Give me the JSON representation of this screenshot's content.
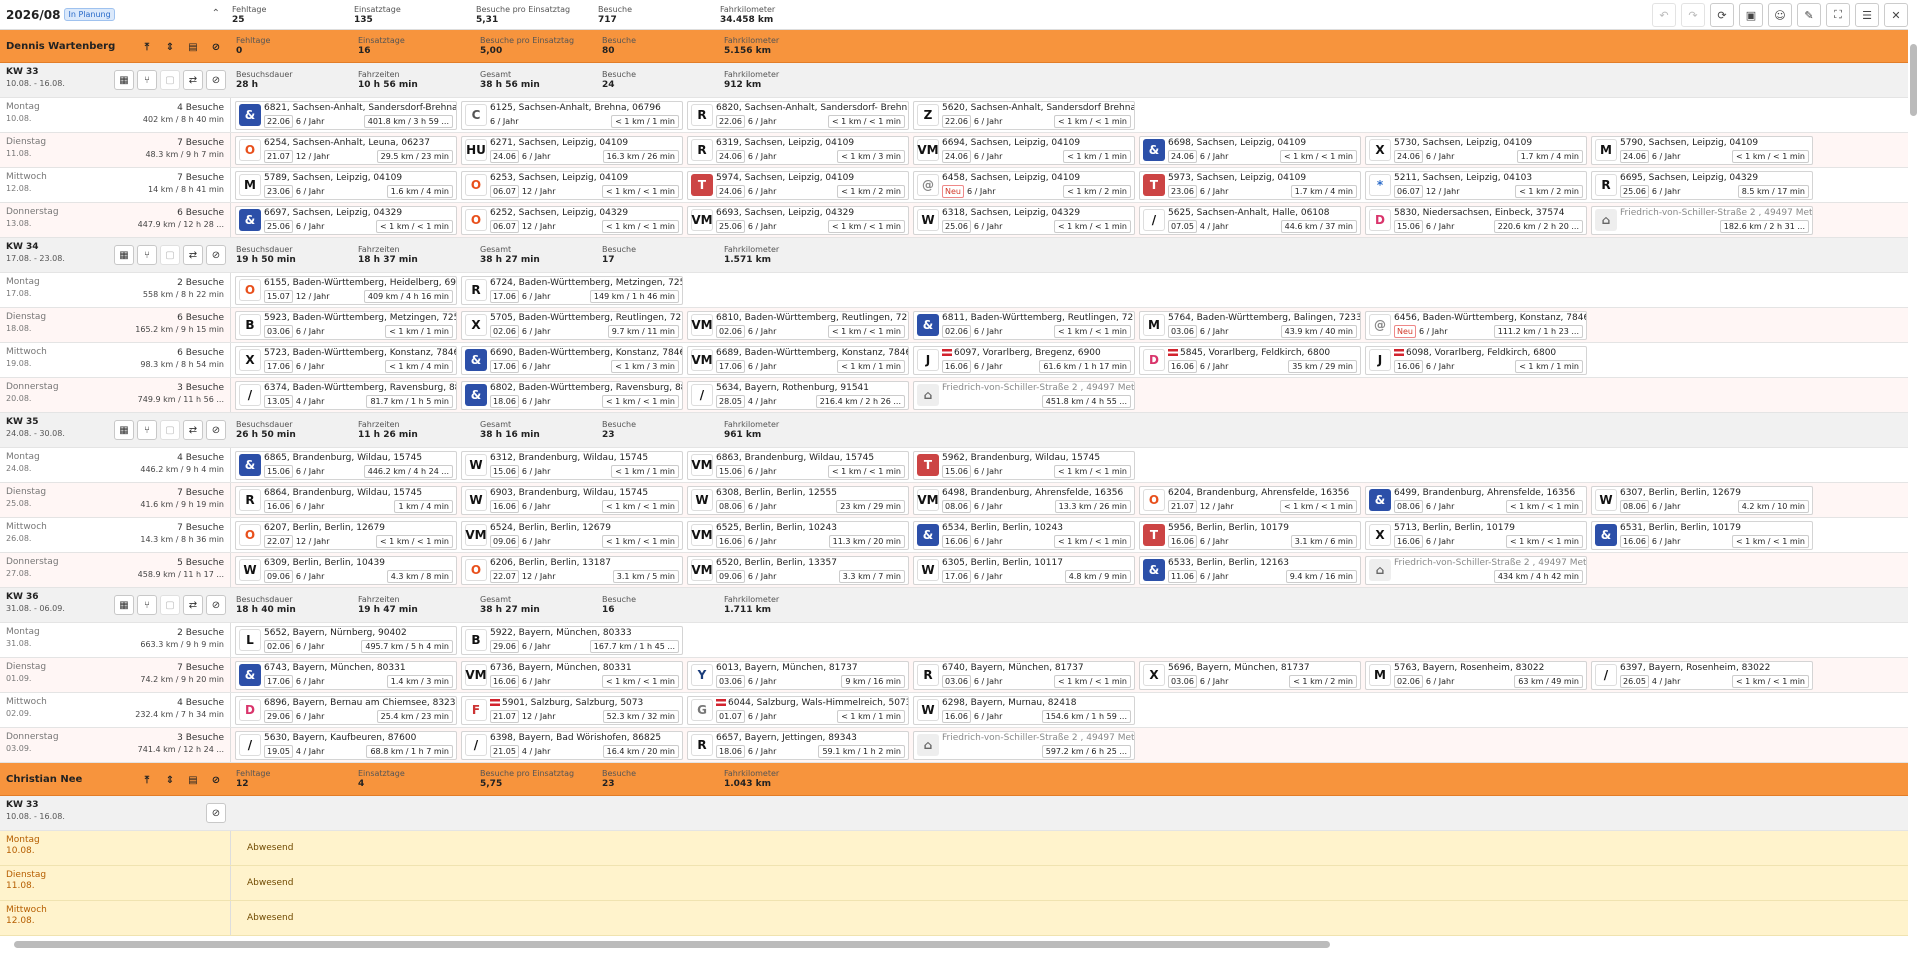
{
  "header": {
    "period": "2026/08",
    "status_badge": "In Planung",
    "stats": [
      [
        "Fehltage",
        "25"
      ],
      [
        "Einsatztage",
        "135"
      ],
      [
        "Besuche pro Einsatztag",
        "5,31"
      ],
      [
        "Besuche",
        "717"
      ],
      [
        "Fahrkilometer",
        "34.458 km"
      ]
    ]
  },
  "rows": [
    {
      "type": "emp",
      "name": "Dennis Wartenberg",
      "stats": [
        [
          "Fehltage",
          "0"
        ],
        [
          "Einsatztage",
          "16"
        ],
        [
          "Besuche pro Einsatztag",
          "5,00"
        ],
        [
          "Besuche",
          "80"
        ],
        [
          "Fahrkilometer",
          "5.156 km"
        ]
      ]
    },
    {
      "type": "wk",
      "week": "KW 33",
      "range": "10.08. - 16.08.",
      "stats": [
        [
          "Besuchsdauer",
          "28 h"
        ],
        [
          "Fahrzeiten",
          "10 h 56 min"
        ],
        [
          "Gesamt",
          "38 h 56 min"
        ],
        [
          "Besuche",
          "24"
        ],
        [
          "Fahrkilometer",
          "912 km"
        ]
      ]
    },
    {
      "type": "dy",
      "day": "Montag",
      "date": "10.08.",
      "visits": "4 Besuche",
      "sum": "402 km / 8 h 40 min",
      "cards": [
        [
          "&",
          "6821, Sachsen-Anhalt, Sandersdorf-Brehna...",
          "22.06",
          "6 / Jahr",
          "401.8 km / 3 h 59 ..."
        ],
        [
          "C",
          "6125, Sachsen-Anhalt, Brehna, 06796",
          "",
          "6 / Jahr",
          "< 1 km / 1 min"
        ],
        [
          "R",
          "6820, Sachsen-Anhalt, Sandersdorf- Brehn...",
          "22.06",
          "6 / Jahr",
          "< 1 km / < 1 min"
        ],
        [
          "Z",
          "5620, Sachsen-Anhalt, Sandersdorf Brehna...",
          "22.06",
          "6 / Jahr",
          "< 1 km / < 1 min"
        ]
      ]
    },
    {
      "type": "dy",
      "alt": true,
      "day": "Dienstag",
      "date": "11.08.",
      "visits": "7 Besuche",
      "sum": "48.3 km / 9 h 7 min",
      "cards": [
        [
          "O",
          "6254, Sachsen-Anhalt, Leuna, 06237",
          "21.07",
          "12 / Jahr",
          "29.5 km / 23 min"
        ],
        [
          "HU",
          "6271, Sachsen, Leipzig, 04109",
          "24.06",
          "6 / Jahr",
          "16.3 km / 26 min"
        ],
        [
          "R",
          "6319, Sachsen, Leipzig, 04109",
          "24.06",
          "6 / Jahr",
          "< 1 km / 3 min"
        ],
        [
          "VM",
          "6694, Sachsen, Leipzig, 04109",
          "24.06",
          "6 / Jahr",
          "< 1 km / 1 min"
        ],
        [
          "&",
          "6698, Sachsen, Leipzig, 04109",
          "24.06",
          "6 / Jahr",
          "< 1 km / < 1 min"
        ],
        [
          "X",
          "5730, Sachsen, Leipzig, 04109",
          "24.06",
          "6 / Jahr",
          "1.7 km / 4 min"
        ],
        [
          "M",
          "5790, Sachsen, Leipzig, 04109",
          "24.06",
          "6 / Jahr",
          "< 1 km / < 1 min"
        ]
      ]
    },
    {
      "type": "dy",
      "day": "Mittwoch",
      "date": "12.08.",
      "visits": "7 Besuche",
      "sum": "14 km / 8 h 41 min",
      "cards": [
        [
          "M",
          "5789, Sachsen, Leipzig, 04109",
          "23.06",
          "6 / Jahr",
          "1.6 km / 4 min"
        ],
        [
          "O",
          "6253, Sachsen, Leipzig, 04109",
          "06.07",
          "12 / Jahr",
          "< 1 km / < 1 min"
        ],
        [
          "T",
          "5974, Sachsen, Leipzig, 04109",
          "24.06",
          "6 / Jahr",
          "< 1 km / 2 min"
        ],
        [
          "@",
          "6458, Sachsen, Leipzig, 04109",
          "Neu",
          "6 / Jahr",
          "< 1 km / 2 min"
        ],
        [
          "T",
          "5973, Sachsen, Leipzig, 04109",
          "23.06",
          "6 / Jahr",
          "1.7 km / 4 min"
        ],
        [
          "*",
          "5211, Sachsen, Leipzig, 04103",
          "06.07",
          "12 / Jahr",
          "< 1 km / 2 min"
        ],
        [
          "R",
          "6695, Sachsen, Leipzig, 04329",
          "25.06",
          "6 / Jahr",
          "8.5 km / 17 min"
        ]
      ]
    },
    {
      "type": "dy",
      "alt": true,
      "day": "Donnerstag",
      "date": "13.08.",
      "visits": "6 Besuche",
      "sum": "447.9 km / 12 h 28 ...",
      "cards": [
        [
          "&",
          "6697, Sachsen, Leipzig, 04329",
          "25.06",
          "6 / Jahr",
          "< 1 km / < 1 min"
        ],
        [
          "O",
          "6252, Sachsen, Leipzig, 04329",
          "06.07",
          "12 / Jahr",
          "< 1 km / < 1 min"
        ],
        [
          "VM",
          "6693, Sachsen, Leipzig, 04329",
          "25.06",
          "6 / Jahr",
          "< 1 km / < 1 min"
        ],
        [
          "W",
          "6318, Sachsen, Leipzig, 04329",
          "25.06",
          "6 / Jahr",
          "< 1 km / < 1 min"
        ],
        [
          "/",
          "5625, Sachsen-Anhalt, Halle, 06108",
          "07.05",
          "4 / Jahr",
          "44.6 km / 37 min"
        ],
        [
          "D",
          "5830, Niedersachsen, Einbeck, 37574",
          "15.06",
          "6 / Jahr",
          "220.6 km / 2 h 20 ..."
        ],
        [
          "H",
          "Friedrich-von-Schiller-Straße 2 , 49497 Met...",
          "",
          "",
          "182.6 km / 2 h 31 ..."
        ]
      ]
    },
    {
      "type": "wk",
      "week": "KW 34",
      "range": "17.08. - 23.08.",
      "stats": [
        [
          "Besuchsdauer",
          "19 h 50 min"
        ],
        [
          "Fahrzeiten",
          "18 h 37 min"
        ],
        [
          "Gesamt",
          "38 h 27 min"
        ],
        [
          "Besuche",
          "17"
        ],
        [
          "Fahrkilometer",
          "1.571 km"
        ]
      ]
    },
    {
      "type": "dy",
      "day": "Montag",
      "date": "17.08.",
      "visits": "2 Besuche",
      "sum": "558 km / 8 h 22 min",
      "cards": [
        [
          "O",
          "6155, Baden-Württemberg, Heidelberg, 69...",
          "15.07",
          "12 / Jahr",
          "409 km / 4 h 16 min"
        ],
        [
          "R",
          "6724, Baden-Württemberg, Metzingen, 725...",
          "17.06",
          "6 / Jahr",
          "149 km / 1 h 46 min"
        ]
      ]
    },
    {
      "type": "dy",
      "alt": true,
      "day": "Dienstag",
      "date": "18.08.",
      "visits": "6 Besuche",
      "sum": "165.2 km / 9 h 15 min",
      "cards": [
        [
          "B",
          "5923, Baden-Württemberg, Metzingen, 725...",
          "03.06",
          "6 / Jahr",
          "< 1 km / 1 min"
        ],
        [
          "X",
          "5705, Baden-Württemberg, Reutlingen, 72...",
          "02.06",
          "6 / Jahr",
          "9.7 km / 11 min"
        ],
        [
          "VM",
          "6810, Baden-Württemberg, Reutlingen, 72...",
          "02.06",
          "6 / Jahr",
          "< 1 km / < 1 min"
        ],
        [
          "&",
          "6811, Baden-Württemberg, Reutlingen, 72...",
          "02.06",
          "6 / Jahr",
          "< 1 km / < 1 min"
        ],
        [
          "M",
          "5764, Baden-Württemberg, Balingen, 72336",
          "03.06",
          "6 / Jahr",
          "43.9 km / 40 min"
        ],
        [
          "@",
          "6456, Baden-Württemberg, Konstanz, 78462",
          "Neu",
          "6 / Jahr",
          "111.2 km / 1 h 23 ..."
        ]
      ]
    },
    {
      "type": "dy",
      "day": "Mittwoch",
      "date": "19.08.",
      "visits": "6 Besuche",
      "sum": "98.3 km / 8 h 54 min",
      "cards": [
        [
          "X",
          "5723, Baden-Württemberg, Konstanz, 78462",
          "17.06",
          "6 / Jahr",
          "< 1 km / 4 min"
        ],
        [
          "&",
          "6690, Baden-Württemberg, Konstanz, 78462",
          "17.06",
          "6 / Jahr",
          "< 1 km / 3 min"
        ],
        [
          "VM",
          "6689, Baden-Württemberg, Konstanz, 78462",
          "17.06",
          "6 / Jahr",
          "< 1 km / 1 min"
        ],
        [
          "J",
          "6097, Vorarlberg, Bregenz, 6900",
          "16.06",
          "6 / Jahr",
          "61.6 km / 1 h 17 min"
        ],
        [
          "D",
          "5845, Vorarlberg, Feldkirch, 6800",
          "16.06",
          "6 / Jahr",
          "35 km / 29 min"
        ],
        [
          "J",
          "6098, Vorarlberg, Feldkirch, 6800",
          "16.06",
          "6 / Jahr",
          "< 1 km / 1 min"
        ]
      ]
    },
    {
      "type": "dy",
      "alt": true,
      "day": "Donnerstag",
      "date": "20.08.",
      "visits": "3 Besuche",
      "sum": "749.9 km / 11 h 56 ...",
      "cards": [
        [
          "/",
          "6374, Baden-Württemberg, Ravensburg, 88...",
          "13.05",
          "4 / Jahr",
          "81.7 km / 1 h 5 min"
        ],
        [
          "&",
          "6802, Baden-Württemberg, Ravensburg, 88...",
          "18.06",
          "6 / Jahr",
          "< 1 km / < 1 min"
        ],
        [
          "/",
          "5634, Bayern, Rothenburg, 91541",
          "28.05",
          "4 / Jahr",
          "216.4 km / 2 h 26 ..."
        ],
        [
          "H",
          "Friedrich-von-Schiller-Straße 2 , 49497 Met...",
          "",
          "",
          "451.8 km / 4 h 55 ..."
        ]
      ]
    },
    {
      "type": "wk",
      "week": "KW 35",
      "range": "24.08. - 30.08.",
      "stats": [
        [
          "Besuchsdauer",
          "26 h 50 min"
        ],
        [
          "Fahrzeiten",
          "11 h 26 min"
        ],
        [
          "Gesamt",
          "38 h 16 min"
        ],
        [
          "Besuche",
          "23"
        ],
        [
          "Fahrkilometer",
          "961 km"
        ]
      ]
    },
    {
      "type": "dy",
      "day": "Montag",
      "date": "24.08.",
      "visits": "4 Besuche",
      "sum": "446.2 km / 9 h 4 min",
      "cards": [
        [
          "&",
          "6865, Brandenburg, Wildau, 15745",
          "15.06",
          "6 / Jahr",
          "446.2 km / 4 h 24 ..."
        ],
        [
          "W",
          "6312, Brandenburg, Wildau, 15745",
          "15.06",
          "6 / Jahr",
          "< 1 km / 1 min"
        ],
        [
          "VM",
          "6863, Brandenburg, Wildau, 15745",
          "15.06",
          "6 / Jahr",
          "< 1 km / < 1 min"
        ],
        [
          "T",
          "5962, Brandenburg, Wildau, 15745",
          "15.06",
          "6 / Jahr",
          "< 1 km / < 1 min"
        ]
      ]
    },
    {
      "type": "dy",
      "alt": true,
      "day": "Dienstag",
      "date": "25.08.",
      "visits": "7 Besuche",
      "sum": "41.6 km / 9 h 19 min",
      "cards": [
        [
          "R",
          "6864, Brandenburg, Wildau, 15745",
          "16.06",
          "6 / Jahr",
          "1 km / 4 min"
        ],
        [
          "W",
          "6903, Brandenburg, Wildau, 15745",
          "16.06",
          "6 / Jahr",
          "< 1 km / < 1 min"
        ],
        [
          "W",
          "6308, Berlin, Berlin, 12555",
          "08.06",
          "6 / Jahr",
          "23 km / 29 min"
        ],
        [
          "VM",
          "6498, Brandenburg, Ahrensfelde, 16356",
          "08.06",
          "6 / Jahr",
          "13.3 km / 26 min"
        ],
        [
          "O",
          "6204, Brandenburg, Ahrensfelde, 16356",
          "21.07",
          "12 / Jahr",
          "< 1 km / < 1 min"
        ],
        [
          "&",
          "6499, Brandenburg, Ahrensfelde, 16356",
          "08.06",
          "6 / Jahr",
          "< 1 km / < 1 min"
        ],
        [
          "W",
          "6307, Berlin, Berlin, 12679",
          "08.06",
          "6 / Jahr",
          "4.2 km / 10 min"
        ]
      ]
    },
    {
      "type": "dy",
      "day": "Mittwoch",
      "date": "26.08.",
      "visits": "7 Besuche",
      "sum": "14.3 km / 8 h 36 min",
      "cards": [
        [
          "O",
          "6207, Berlin, Berlin, 12679",
          "22.07",
          "12 / Jahr",
          "< 1 km / < 1 min"
        ],
        [
          "VM",
          "6524, Berlin, Berlin, 12679",
          "09.06",
          "6 / Jahr",
          "< 1 km / < 1 min"
        ],
        [
          "VM",
          "6525, Berlin, Berlin, 10243",
          "16.06",
          "6 / Jahr",
          "11.3 km / 20 min"
        ],
        [
          "&",
          "6534, Berlin, Berlin, 10243",
          "16.06",
          "6 / Jahr",
          "< 1 km / < 1 min"
        ],
        [
          "T",
          "5956, Berlin, Berlin, 10179",
          "16.06",
          "6 / Jahr",
          "3.1 km / 6 min"
        ],
        [
          "X",
          "5713, Berlin, Berlin, 10179",
          "16.06",
          "6 / Jahr",
          "< 1 km / < 1 min"
        ],
        [
          "&",
          "6531, Berlin, Berlin, 10179",
          "16.06",
          "6 / Jahr",
          "< 1 km / < 1 min"
        ]
      ]
    },
    {
      "type": "dy",
      "alt": true,
      "day": "Donnerstag",
      "date": "27.08.",
      "visits": "5 Besuche",
      "sum": "458.9 km / 11 h 17 ...",
      "cards": [
        [
          "W",
          "6309, Berlin, Berlin, 10439",
          "09.06",
          "6 / Jahr",
          "4.3 km / 8 min"
        ],
        [
          "O",
          "6206, Berlin, Berlin, 13187",
          "22.07",
          "12 / Jahr",
          "3.1 km / 5 min"
        ],
        [
          "VM",
          "6520, Berlin, Berlin, 13357",
          "09.06",
          "6 / Jahr",
          "3.3 km / 7 min"
        ],
        [
          "W",
          "6305, Berlin, Berlin, 10117",
          "17.06",
          "6 / Jahr",
          "4.8 km / 9 min"
        ],
        [
          "&",
          "6533, Berlin, Berlin, 12163",
          "11.06",
          "6 / Jahr",
          "9.4 km / 16 min"
        ],
        [
          "H",
          "Friedrich-von-Schiller-Straße 2 , 49497 Met...",
          "",
          "",
          "434 km / 4 h 42 min"
        ]
      ]
    },
    {
      "type": "wk",
      "week": "KW 36",
      "range": "31.08. - 06.09.",
      "stats": [
        [
          "Besuchsdauer",
          "18 h 40 min"
        ],
        [
          "Fahrzeiten",
          "19 h 47 min"
        ],
        [
          "Gesamt",
          "38 h 27 min"
        ],
        [
          "Besuche",
          "16"
        ],
        [
          "Fahrkilometer",
          "1.711 km"
        ]
      ]
    },
    {
      "type": "dy",
      "day": "Montag",
      "date": "31.08.",
      "visits": "2 Besuche",
      "sum": "663.3 km / 9 h 9 min",
      "cards": [
        [
          "L",
          "5652, Bayern, Nürnberg, 90402",
          "02.06",
          "6 / Jahr",
          "495.7 km / 5 h 4 min"
        ],
        [
          "B",
          "5922, Bayern, München, 80333",
          "29.06",
          "6 / Jahr",
          "167.7 km / 1 h 45 ..."
        ]
      ]
    },
    {
      "type": "dy",
      "alt": true,
      "day": "Dienstag",
      "date": "01.09.",
      "visits": "7 Besuche",
      "sum": "74.2 km / 9 h 20 min",
      "cards": [
        [
          "&",
          "6743, Bayern, München, 80331",
          "17.06",
          "6 / Jahr",
          "1.4 km / 3 min"
        ],
        [
          "VM",
          "6736, Bayern, München, 80331",
          "16.06",
          "6 / Jahr",
          "< 1 km / < 1 min"
        ],
        [
          "Y",
          "6013, Bayern, München, 81737",
          "03.06",
          "6 / Jahr",
          "9 km / 16 min"
        ],
        [
          "R",
          "6740, Bayern, München, 81737",
          "03.06",
          "6 / Jahr",
          "< 1 km / < 1 min"
        ],
        [
          "X",
          "5696, Bayern, München, 81737",
          "03.06",
          "6 / Jahr",
          "< 1 km / 2 min"
        ],
        [
          "M",
          "5763, Bayern, Rosenheim, 83022",
          "02.06",
          "6 / Jahr",
          "63 km / 49 min"
        ],
        [
          "/",
          "6397, Bayern, Rosenheim, 83022",
          "26.05",
          "4 / Jahr",
          "< 1 km / < 1 min"
        ]
      ]
    },
    {
      "type": "dy",
      "day": "Mittwoch",
      "date": "02.09.",
      "visits": "4 Besuche",
      "sum": "232.4 km / 7 h 34 min",
      "cards": [
        [
          "D",
          "6896, Bayern, Bernau am Chiemsee, 83233",
          "29.06",
          "6 / Jahr",
          "25.4 km / 23 min"
        ],
        [
          "F",
          "5901, Salzburg, Salzburg, 5073",
          "21.07",
          "12 / Jahr",
          "52.3 km / 32 min"
        ],
        [
          "G",
          "6044, Salzburg, Wals-Himmelreich, 5073",
          "01.07",
          "6 / Jahr",
          "< 1 km / 1 min"
        ],
        [
          "W",
          "6298, Bayern, Murnau, 82418",
          "16.06",
          "6 / Jahr",
          "154.6 km / 1 h 59 ..."
        ]
      ]
    },
    {
      "type": "dy",
      "alt": true,
      "day": "Donnerstag",
      "date": "03.09.",
      "visits": "3 Besuche",
      "sum": "741.4 km / 12 h 24 ...",
      "cards": [
        [
          "/",
          "5630, Bayern, Kaufbeuren, 87600",
          "19.05",
          "4 / Jahr",
          "68.8 km / 1 h 7 min"
        ],
        [
          "/",
          "6398, Bayern, Bad Wörishofen, 86825",
          "21.05",
          "4 / Jahr",
          "16.4 km / 20 min"
        ],
        [
          "R",
          "6657, Bayern, Jettingen, 89343",
          "18.06",
          "6 / Jahr",
          "59.1 km / 1 h 2 min"
        ],
        [
          "H",
          "Friedrich-von-Schiller-Straße 2 , 49497 Met...",
          "",
          "",
          "597.2 km / 6 h 25 ..."
        ]
      ]
    },
    {
      "type": "emp",
      "name": "Christian Nee",
      "stats": [
        [
          "Fehltage",
          "12"
        ],
        [
          "Einsatztage",
          "4"
        ],
        [
          "Besuche pro Einsatztag",
          "5,75"
        ],
        [
          "Besuche",
          "23"
        ],
        [
          "Fahrkilometer",
          "1.043 km"
        ]
      ]
    },
    {
      "type": "wk",
      "week": "KW 33",
      "range": "10.08. - 16.08.",
      "short": true,
      "stats": []
    },
    {
      "type": "off",
      "day": "Montag",
      "date": "10.08.",
      "text": "Abwesend"
    },
    {
      "type": "off",
      "day": "Dienstag",
      "date": "11.08.",
      "text": "Abwesend"
    },
    {
      "type": "off",
      "day": "Mittwoch",
      "date": "12.08.",
      "text": "Abwesend"
    }
  ]
}
